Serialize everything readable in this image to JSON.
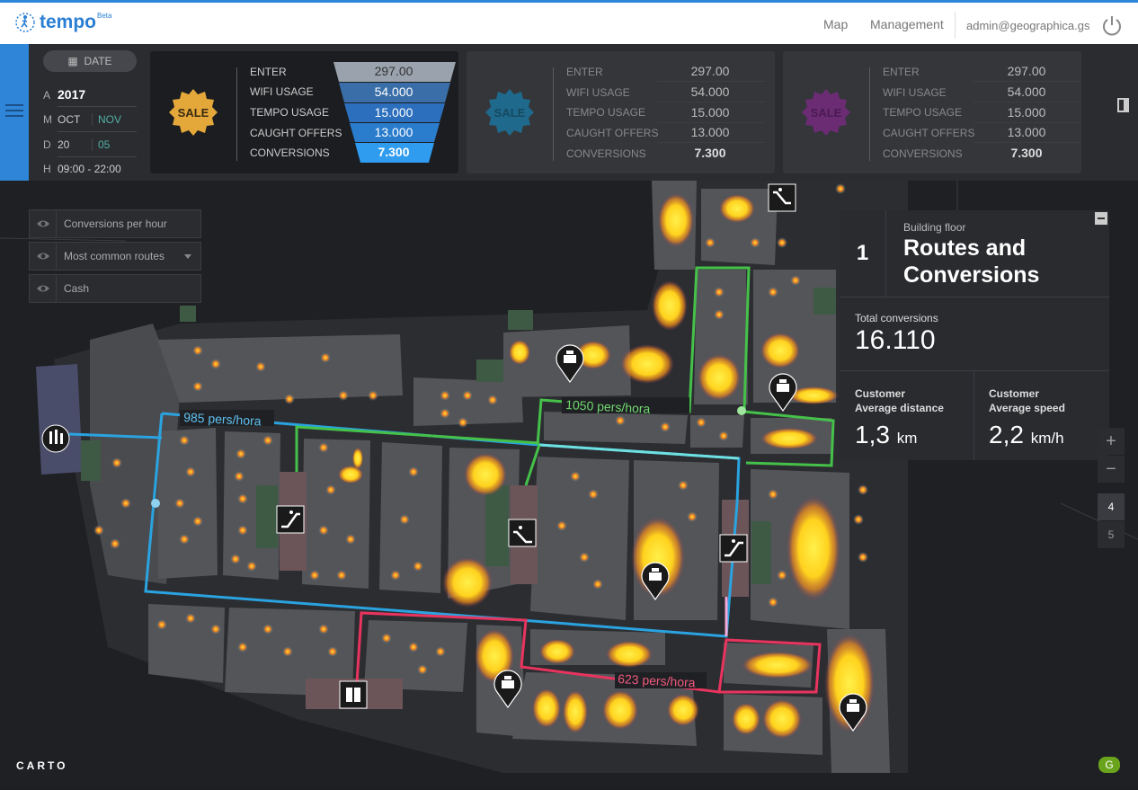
{
  "app": {
    "brand": "tempo",
    "badge": "Beta"
  },
  "nav": {
    "map": "Map",
    "management": "Management",
    "user": "admin@geographica.gs"
  },
  "date_filter": {
    "button": "DATE",
    "year_key": "A",
    "year": "2017",
    "month_key": "M",
    "months": [
      "OCT",
      "NOV"
    ],
    "day_key": "D",
    "days": [
      "20",
      "05"
    ],
    "hour_key": "H",
    "hours": "09:00 - 22:00"
  },
  "funnel_labels": [
    "ENTER",
    "WIFI USAGE",
    "TEMPO USAGE",
    "CAUGHT OFFERS",
    "CONVERSIONS"
  ],
  "cards": [
    {
      "badge": "SALE",
      "badge_color": "#e4a83a",
      "values": [
        "297.00",
        "54.000",
        "15.000",
        "13.000",
        "7.300"
      ]
    },
    {
      "badge": "SALE",
      "badge_color": "#1f6a8c",
      "values": [
        "297.00",
        "54.000",
        "15.000",
        "13.000",
        "7.300"
      ]
    },
    {
      "badge": "SALE",
      "badge_color": "#6b2c74",
      "values": [
        "297.00",
        "54.000",
        "15.000",
        "13.000",
        "7.300"
      ]
    }
  ],
  "layers": [
    "Conversions per hour",
    "Most common routes",
    "Cash"
  ],
  "info": {
    "floor": "1",
    "floor_label": "Building floor",
    "title": "Routes and Conversions",
    "total_label": "Total conversions",
    "total_value": "16.110",
    "distance_l1": "Customer",
    "distance_l2": "Average distance",
    "distance_value": "1,3",
    "distance_unit": "km",
    "speed_l1": "Customer",
    "speed_l2": "Average speed",
    "speed_value": "2,2",
    "speed_unit": "km/h"
  },
  "routes": {
    "blue": "985 pers/hora",
    "green": "1050 pers/hora",
    "red": "623 pers/hora"
  },
  "map_controls": {
    "zoom_in": "+",
    "zoom_out": "−",
    "levels": [
      "4",
      "5"
    ]
  },
  "attribution": "CARTO",
  "g_button": "G",
  "colors": {
    "accent": "#2f86d8",
    "route_blue": "#2aa3e0",
    "route_green": "#45c14a",
    "route_red": "#e8345e"
  }
}
